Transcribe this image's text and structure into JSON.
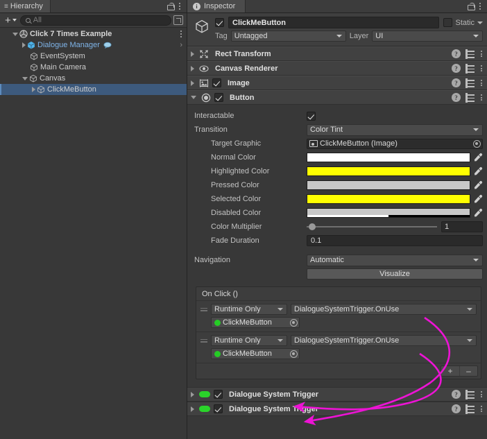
{
  "hierarchy": {
    "tab_label": "Hierarchy",
    "toolbar": {
      "add_label": "+",
      "search_placeholder": "All"
    },
    "items": [
      {
        "label": "Click 7 Times Example",
        "icon": "unity-scene-icon",
        "type": "scene",
        "depth": 0,
        "expanded": true
      },
      {
        "label": "Dialogue Manager",
        "icon": "prefab-cube-icon",
        "type": "prefab",
        "depth": 1,
        "expanded": false,
        "badge_icon": "dialogue-bubble-icon"
      },
      {
        "label": "EventSystem",
        "icon": "gameobject-cube-icon",
        "type": "gameobject",
        "depth": 1,
        "expanded": null
      },
      {
        "label": "Main Camera",
        "icon": "gameobject-cube-icon",
        "type": "gameobject",
        "depth": 1,
        "expanded": null
      },
      {
        "label": "Canvas",
        "icon": "gameobject-cube-icon",
        "type": "gameobject",
        "depth": 1,
        "expanded": true
      },
      {
        "label": "ClickMeButton",
        "icon": "gameobject-cube-icon",
        "type": "gameobject",
        "depth": 2,
        "expanded": false,
        "selected": true
      }
    ]
  },
  "inspector": {
    "tab_label": "Inspector",
    "gameobject": {
      "enabled": true,
      "name": "ClickMeButton",
      "static_label": "Static",
      "static_checked": false,
      "tag_label": "Tag",
      "tag_value": "Untagged",
      "layer_label": "Layer",
      "layer_value": "UI"
    },
    "components": [
      {
        "title": "Rect Transform",
        "icon": "rect-transform-icon",
        "expanded": false,
        "has_checkbox": false
      },
      {
        "title": "Canvas Renderer",
        "icon": "eye-icon",
        "expanded": false,
        "has_checkbox": false
      },
      {
        "title": "Image",
        "icon": "image-icon",
        "expanded": false,
        "has_checkbox": true,
        "checked": true
      },
      {
        "title": "Button",
        "icon": "button-icon",
        "expanded": true,
        "has_checkbox": true,
        "checked": true
      }
    ],
    "button_component": {
      "interactable_label": "Interactable",
      "interactable_checked": true,
      "transition_label": "Transition",
      "transition_value": "Color Tint",
      "target_graphic_label": "Target Graphic",
      "target_graphic_value": "ClickMeButton (Image)",
      "colors": [
        {
          "label": "Normal Color",
          "hex": "#FFFFFF",
          "alpha": 1.0
        },
        {
          "label": "Highlighted Color",
          "hex": "#FFFF00",
          "alpha": 1.0
        },
        {
          "label": "Pressed Color",
          "hex": "#C8C8C8",
          "alpha": 1.0
        },
        {
          "label": "Selected Color",
          "hex": "#FFFF00",
          "alpha": 1.0
        },
        {
          "label": "Disabled Color",
          "hex": "#C8C8C8",
          "alpha": 0.5
        }
      ],
      "color_multiplier_label": "Color Multiplier",
      "color_multiplier_value": "1",
      "fade_duration_label": "Fade Duration",
      "fade_duration_value": "0.1",
      "navigation_label": "Navigation",
      "navigation_value": "Automatic",
      "visualize_label": "Visualize"
    },
    "on_click": {
      "title": "On Click ()",
      "entries": [
        {
          "mode": "Runtime Only",
          "function": "DialogueSystemTrigger.OnUse",
          "object": "ClickMeButton"
        },
        {
          "mode": "Runtime Only",
          "function": "DialogueSystemTrigger.OnUse",
          "object": "ClickMeButton"
        }
      ],
      "add_label": "+",
      "remove_label": "–"
    },
    "bottom_components": [
      {
        "title": "Dialogue System Trigger",
        "enabled": true
      },
      {
        "title": "Dialogue System Trigger",
        "enabled": true
      }
    ]
  },
  "annotations": {
    "arrow_color": "#ED13D5",
    "arrows": [
      {
        "from": "on-click-entry-0-function",
        "to": "dialogue-system-trigger-0"
      },
      {
        "from": "on-click-entry-1-function",
        "to": "dialogue-system-trigger-1"
      }
    ]
  }
}
